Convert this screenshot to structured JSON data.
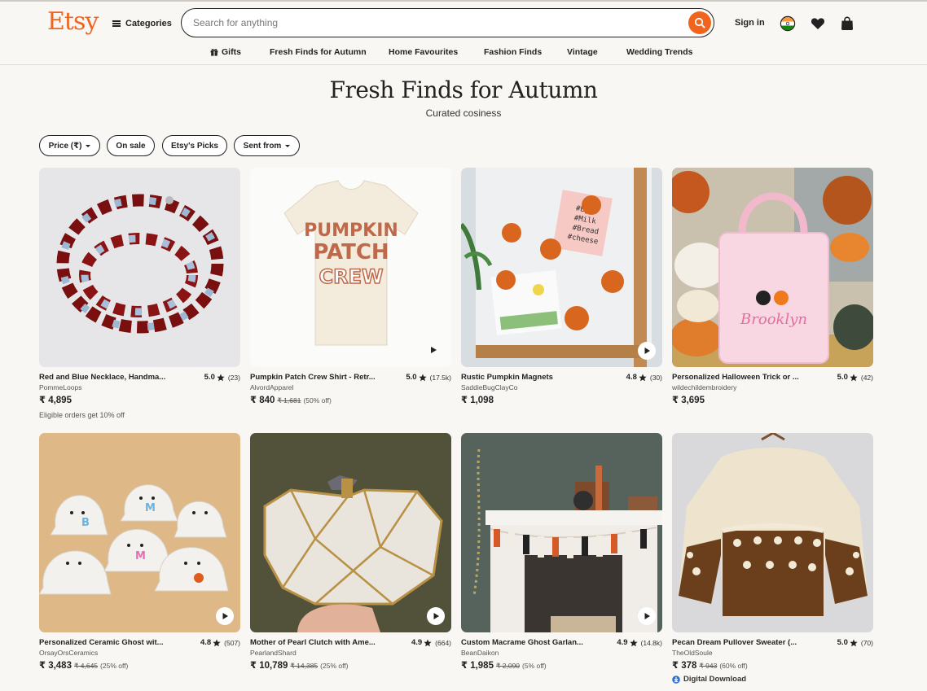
{
  "header": {
    "logo": "Etsy",
    "categories_label": "Categories",
    "search_placeholder": "Search for anything",
    "signin_label": "Sign in"
  },
  "nav": {
    "items": [
      "Gifts",
      "Fresh Finds for Autumn",
      "Home Favourites",
      "Fashion Finds",
      "Vintage",
      "Wedding Trends"
    ]
  },
  "page": {
    "title": "Fresh Finds for Autumn",
    "subtitle": "Curated cosiness"
  },
  "filters": [
    "Price (₹)",
    "On sale",
    "Etsy's Picks",
    "Sent from"
  ],
  "listings": [
    {
      "title": "Red and Blue Necklace, Handma...",
      "rating": "5.0",
      "count": "(23)",
      "shop": "PommeLoops",
      "price": "₹ 4,895",
      "original": "",
      "discount": "",
      "extra": "Eligible orders get 10% off"
    },
    {
      "title": "Pumpkin Patch Crew Shirt - Retr...",
      "rating": "5.0",
      "count": "(17.5k)",
      "shop": "AlvordApparel",
      "price": "₹ 840",
      "original": "₹ 1,681",
      "discount": "(50% off)",
      "extra": ""
    },
    {
      "title": "Rustic Pumpkin Magnets",
      "rating": "4.8",
      "count": "(30)",
      "shop": "SaddieBugClayCo",
      "price": "₹ 1,098",
      "original": "",
      "discount": "",
      "extra": ""
    },
    {
      "title": "Personalized Halloween Trick or ...",
      "rating": "5.0",
      "count": "(42)",
      "shop": "wildechildembroidery",
      "price": "₹ 3,695",
      "original": "",
      "discount": "",
      "extra": ""
    },
    {
      "title": "Personalized Ceramic Ghost wit...",
      "rating": "4.8",
      "count": "(507)",
      "shop": "OrsayOrsCeramics",
      "price": "₹ 3,483",
      "original": "₹ 4,645",
      "discount": "(25% off)",
      "extra": ""
    },
    {
      "title": "Mother of Pearl Clutch with Ame...",
      "rating": "4.9",
      "count": "(664)",
      "shop": "PearlandShard",
      "price": "₹ 10,789",
      "original": "₹ 14,385",
      "discount": "(25% off)",
      "extra": ""
    },
    {
      "title": "Custom Macrame Ghost Garlan...",
      "rating": "4.9",
      "count": "(14.8k)",
      "shop": "BeanDaikon",
      "price": "₹ 1,985",
      "original": "₹ 2,090",
      "discount": "(5% off)",
      "extra": ""
    },
    {
      "title": "Pecan Dream Pullover Sweater (...",
      "rating": "5.0",
      "count": "(70)",
      "shop": "TheOldSoule",
      "price": "₹ 378",
      "original": "₹ 943",
      "discount": "(60% off)",
      "extra": "Digital Download"
    }
  ],
  "colors": {
    "brand": "#f1641e",
    "background": "#f8f7f4",
    "text": "#222222"
  },
  "icons": [
    "menu-icon",
    "search-icon",
    "flag-india-icon",
    "heart-icon",
    "shopping-bag-icon",
    "gift-icon",
    "star-icon",
    "play-icon",
    "download-icon"
  ]
}
